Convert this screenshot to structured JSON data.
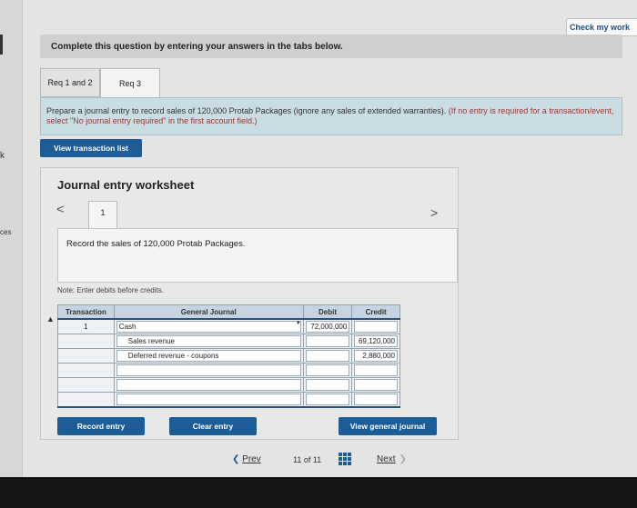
{
  "header": {
    "check_button": "Check my work",
    "instruction": "Complete this question by entering your answers in the tabs below."
  },
  "left_edge": {
    "star": "k",
    "label": "ces"
  },
  "tabs": [
    {
      "label": "Req 1 and 2"
    },
    {
      "label": "Req 3"
    }
  ],
  "prompt": {
    "text": "Prepare a journal entry to record sales of 120,000 Protab Packages (ignore any sales of extended warranties). ",
    "hint": "(If no entry is required for a transaction/event, select \"No journal entry required\" in the first account field.)"
  },
  "view_transaction_list": "View transaction list",
  "worksheet": {
    "title": "Journal entry worksheet",
    "page": "1",
    "prev": "<",
    "next": ">",
    "description": "Record the sales of 120,000 Protab Packages.",
    "note": "Note: Enter debits before credits."
  },
  "table": {
    "headers": [
      "Transaction",
      "General Journal",
      "Debit",
      "Credit"
    ],
    "rows": [
      {
        "transaction": "1",
        "account": "Cash",
        "debit": "72,000,000",
        "credit": ""
      },
      {
        "transaction": "",
        "account": "Sales revenue",
        "debit": "",
        "credit": "69,120,000"
      },
      {
        "transaction": "",
        "account": "Deferred revenue - coupons",
        "debit": "",
        "credit": "2,880,000"
      },
      {
        "transaction": "",
        "account": "",
        "debit": "",
        "credit": ""
      },
      {
        "transaction": "",
        "account": "",
        "debit": "",
        "credit": ""
      },
      {
        "transaction": "",
        "account": "",
        "debit": "",
        "credit": ""
      }
    ]
  },
  "buttons": {
    "record": "Record entry",
    "clear": "Clear entry",
    "view_journal": "View general journal"
  },
  "pager": {
    "prev": "Prev",
    "count": "11 of 11",
    "next": "Next"
  },
  "colors": {
    "accent": "#1d5d97",
    "prompt_bg": "#c9dde2",
    "table_header": "#c6d3e0"
  }
}
